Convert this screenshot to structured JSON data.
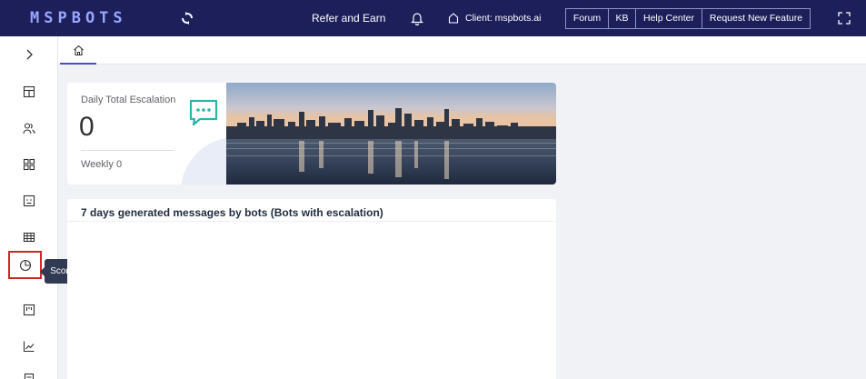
{
  "topbar": {
    "logo_text": "MSPBOTS",
    "refer_label": "Refer and Earn",
    "client_label": "Client: mspbots.ai",
    "buttons": {
      "forum": "Forum",
      "kb": "KB",
      "help": "Help Center",
      "request": "Request New Feature"
    }
  },
  "sidebar": {
    "tooltip": "Scorecards",
    "items": [
      {
        "icon": "expand-arrow-icon"
      },
      {
        "icon": "dashboard-icon"
      },
      {
        "icon": "users-icon"
      },
      {
        "icon": "apps-grid-icon"
      },
      {
        "icon": "bot-icon"
      },
      {
        "icon": "table-icon"
      },
      {
        "icon": "scorecards-pie-icon",
        "active": true
      },
      {
        "icon": "kanban-icon"
      },
      {
        "icon": "line-chart-icon"
      },
      {
        "icon": "report-icon"
      }
    ]
  },
  "breadcrumb": {
    "home_icon": "home-icon"
  },
  "escalation": {
    "title": "Daily Total Escalation",
    "daily_value": "0",
    "weekly_label": "Weekly",
    "weekly_value": "0",
    "icon": "chat-bubble-icon"
  },
  "messages_panel": {
    "title": "7 days generated messages by bots (Bots with escalation)"
  },
  "colors": {
    "topbar_bg": "#1c1f5a",
    "accent_teal": "#26b7a6",
    "active_outline": "#d6232a",
    "tooltip_bg": "#303a52"
  }
}
